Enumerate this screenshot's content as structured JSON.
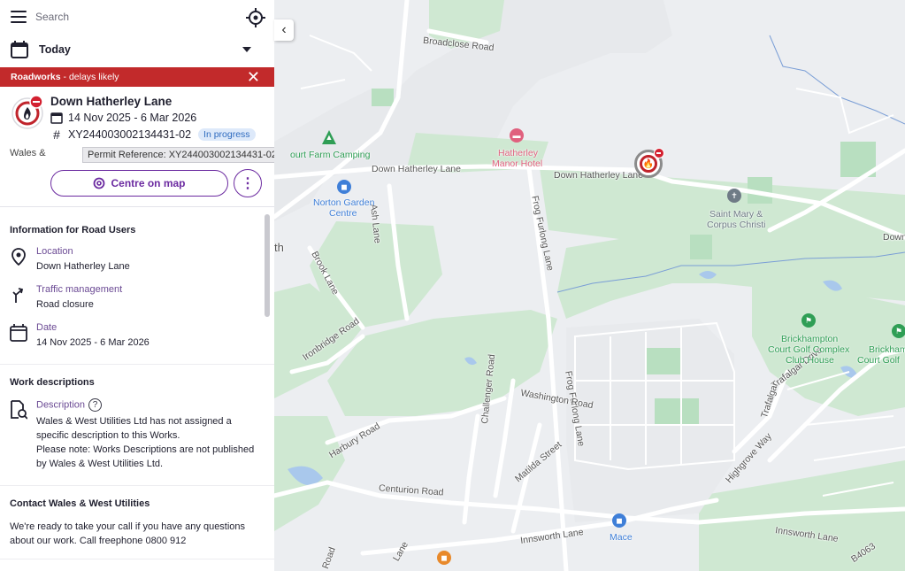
{
  "search": {
    "placeholder": "Search"
  },
  "date_filter": {
    "label": "Today"
  },
  "banner": {
    "type": "Roadworks",
    "note": "- delays likely"
  },
  "work": {
    "title": "Down Hatherley Lane",
    "dates": "14 Nov 2025 - 6 Mar 2026",
    "reference": "XY244003002134431-02",
    "status": "In progress",
    "promoter_short": "Wales &",
    "tooltip": "Permit Reference: XY244003002134431-02",
    "centre_label": "Centre on map"
  },
  "info": {
    "heading": "Information for Road Users",
    "location_label": "Location",
    "location_value": "Down Hatherley Lane",
    "traffic_label": "Traffic management",
    "traffic_value": "Road closure",
    "date_label": "Date",
    "date_value": "14 Nov 2025 - 6 Mar 2026"
  },
  "descriptions": {
    "heading": "Work descriptions",
    "label": "Description",
    "line1": "Wales & West Utilities Ltd has not assigned a specific description to this Works.",
    "line2": "Please note: Works Descriptions are not published by Wales & West Utilities Ltd."
  },
  "contact": {
    "heading": "Contact Wales & West Utilities",
    "text": "We're ready to take your call if you have any questions about our work. Call freephone 0800 912"
  },
  "map": {
    "roads": {
      "broadclose": "Broadclose Road",
      "dhl_west": "Down Hatherley Lane",
      "dhl_east": "Down Hatherley Lane",
      "dhl_far": "Down",
      "ash": "Ash Lane",
      "frog1": "Frog Furlong Lane",
      "frog2": "Frog Furlong Lane",
      "brook": "Brook Lane",
      "ironbridge": "Ironbridge Road",
      "washington": "Washington Road",
      "challenger": "Challenger Road",
      "matilda": "Matilda Street",
      "harbury": "Harbury Road",
      "centurion": "Centurion Road",
      "innsworth1": "Innsworth Lane",
      "innsworth2": "Innsworth Lane",
      "highgrove": "Highgrove Way",
      "trafalgar1": "Trafalgar Drive",
      "trafalgar2": "Trafalgar",
      "b4063": "B4063",
      "lane_s": "Lane",
      "road_s": "Road",
      "th": "th"
    },
    "pois": {
      "farm": "ourt Farm Camping",
      "hotel1": "Hatherley",
      "hotel2": "Manor Hotel",
      "garden1": "Norton Garden",
      "garden2": "Centre",
      "church1": "Saint Mary &",
      "church2": "Corpus Christi",
      "golf1a": "Brickhampton",
      "golf1b": "Court Golf Complex",
      "golf1c": "Club House",
      "golf2a": "Brickham",
      "golf2b": "Court Golf",
      "mace": "Mace"
    },
    "colors": {
      "green": "#cfe8d2",
      "dark_green": "#b8dfc0",
      "water": "#a9c8ec",
      "road": "#ffffff",
      "hotel": "#e0607e",
      "poi_blue": "#3f7fd8",
      "poi_green": "#2f9e55",
      "poi_orange": "#e8892b",
      "church": "#6f7b86"
    }
  }
}
